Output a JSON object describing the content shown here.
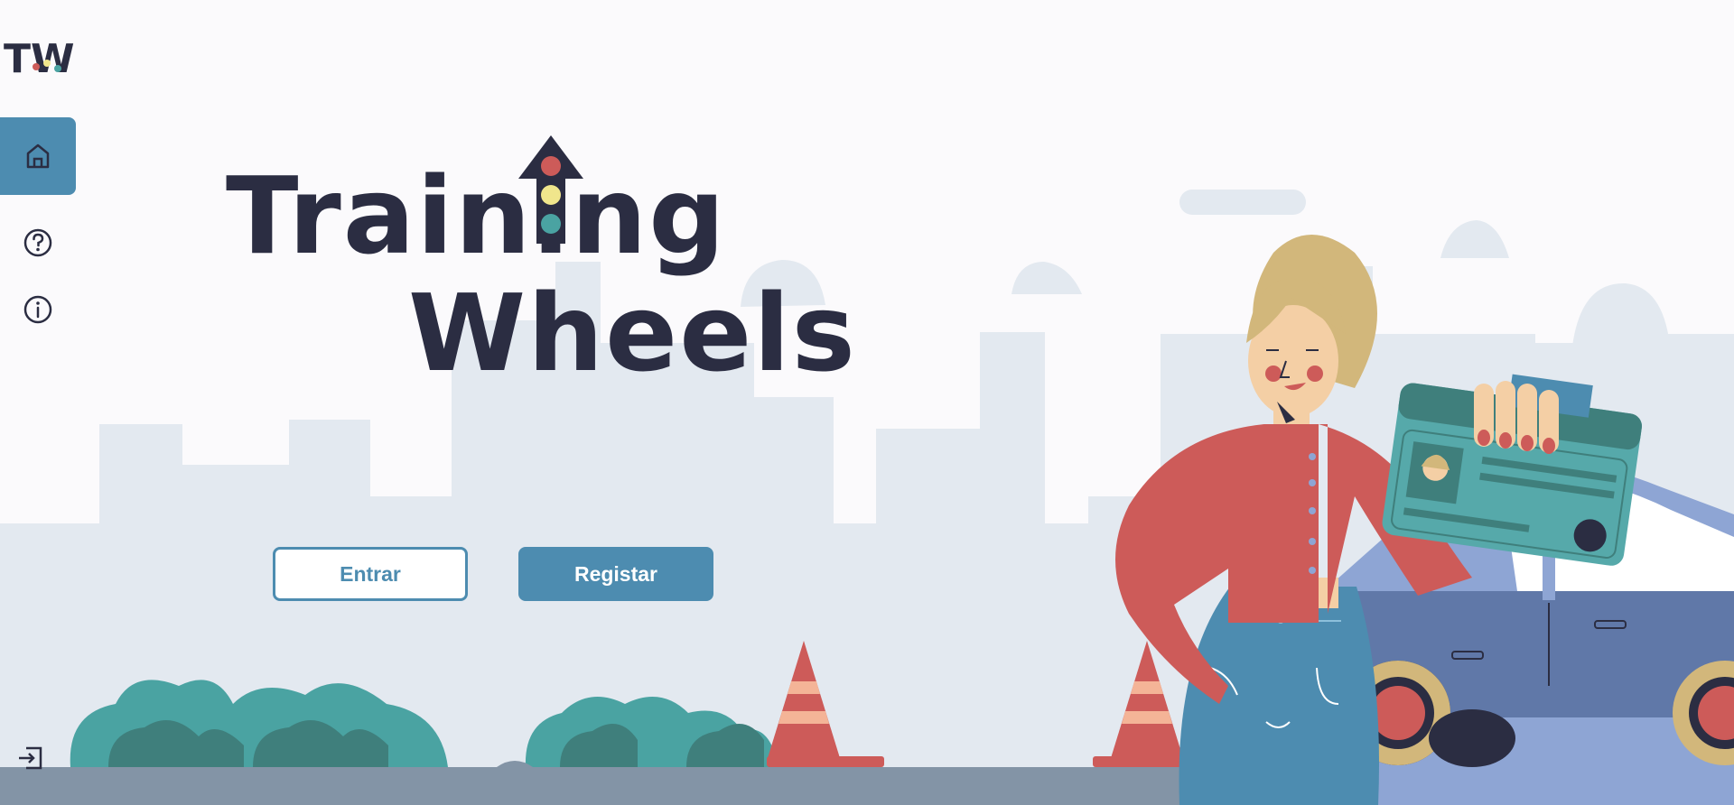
{
  "app": {
    "logo_text": "TW",
    "title_line1": "Training",
    "title_line2": "Wheels"
  },
  "sidebar": {
    "items": [
      {
        "icon": "home-icon",
        "active": true
      },
      {
        "icon": "help-icon",
        "active": false
      },
      {
        "icon": "info-icon",
        "active": false
      },
      {
        "icon": "logout-icon",
        "active": false
      }
    ]
  },
  "actions": {
    "login_label": "Entrar",
    "register_label": "Registar"
  },
  "colors": {
    "accent": "#4d8cb0",
    "title": "#2b2d42",
    "jacket": "#cd5b59",
    "card": "#56a9aa",
    "car": "#6078a8",
    "bush": "#4aa3a2",
    "road": "#8394a6",
    "city": "#e3e9f0"
  }
}
